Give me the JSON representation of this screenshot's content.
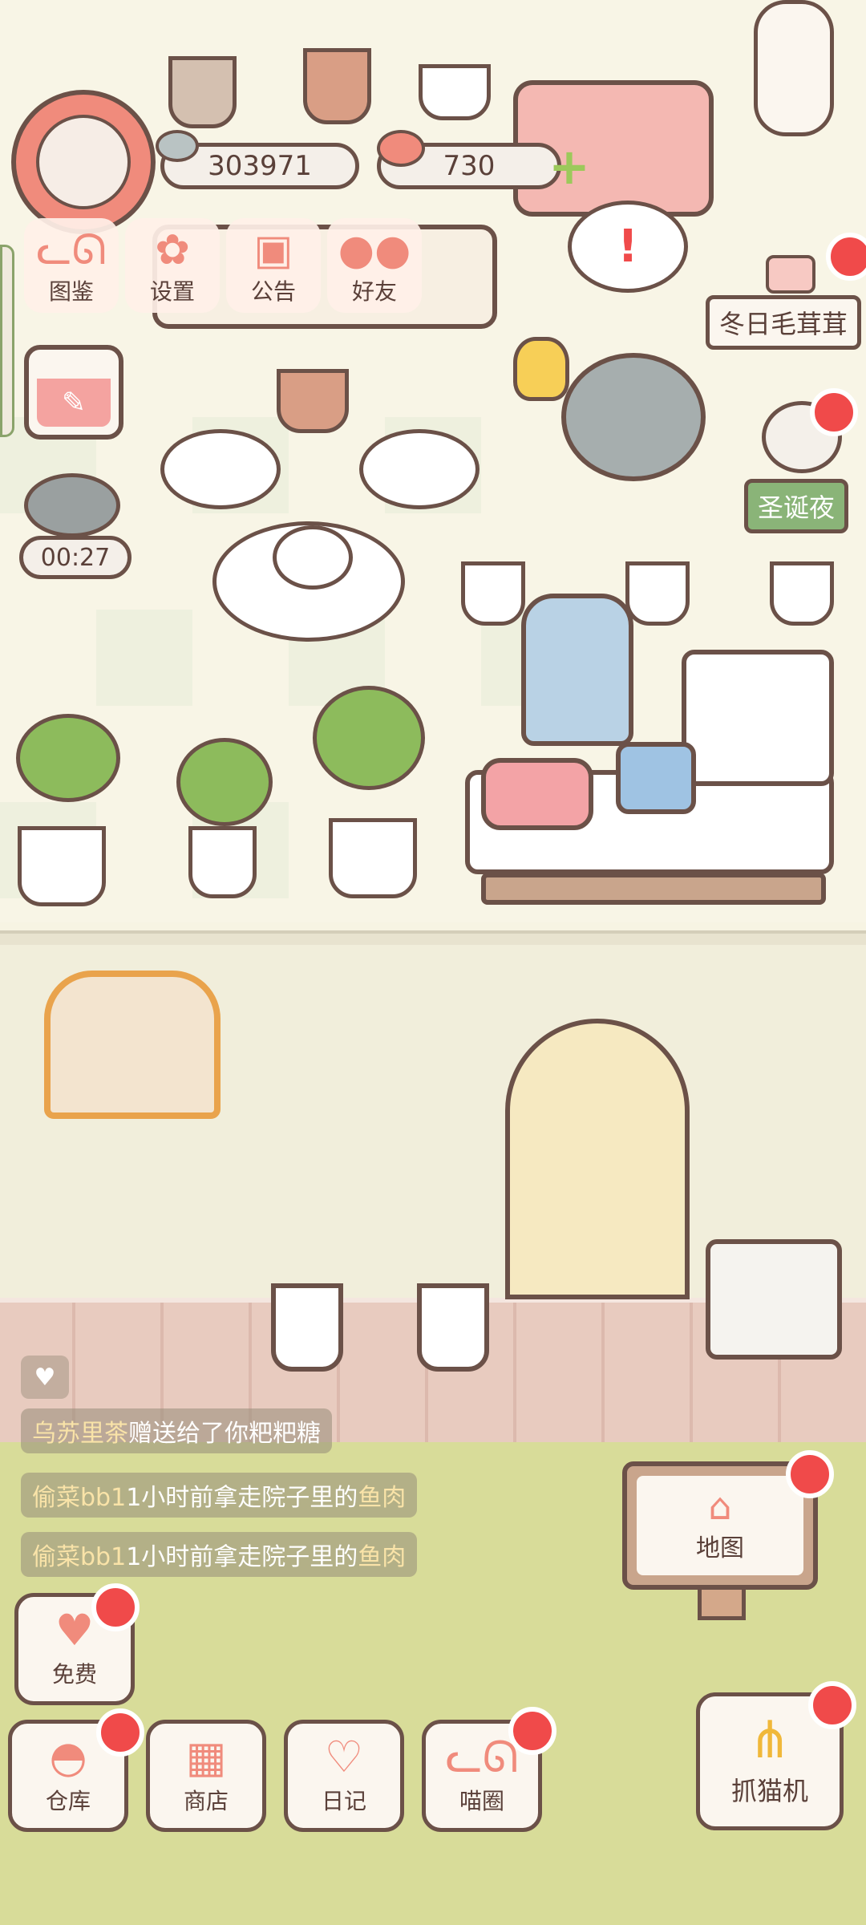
{
  "hud": {
    "fish_count": "303971",
    "heart_count": "730",
    "timer": "00:27"
  },
  "menu": {
    "items": [
      {
        "label": "图鉴",
        "icon": "cat-head-icon"
      },
      {
        "label": "设置",
        "icon": "gear-icon"
      },
      {
        "label": "公告",
        "icon": "gift-icon"
      },
      {
        "label": "好友",
        "icon": "friends-icon"
      }
    ]
  },
  "scene": {
    "cat_name_tag": "冬日毛茸茸",
    "event_tag": "圣诞夜"
  },
  "feed": [
    {
      "who": "乌苏里茶",
      "action": "赠送给了你粑粑糖",
      "item": ""
    },
    {
      "who": "偷菜bb1",
      "action": "1小时前拿走院子里的",
      "item": "鱼肉"
    },
    {
      "who": "偷菜bb1",
      "action": "1小时前拿走院子里的",
      "item": "鱼肉"
    }
  ],
  "buttons": {
    "map": "地图",
    "free": "免费",
    "warehouse": "仓库",
    "shop": "商店",
    "diary": "日记",
    "cat_circle": "喵圈",
    "claw_machine": "抓猫机"
  },
  "colors": {
    "outline": "#6b5148",
    "accent_pink": "#f08b7c",
    "badge_red": "#f04a4a",
    "tag_green": "#8ab478",
    "yard_green": "#d8dc99"
  }
}
